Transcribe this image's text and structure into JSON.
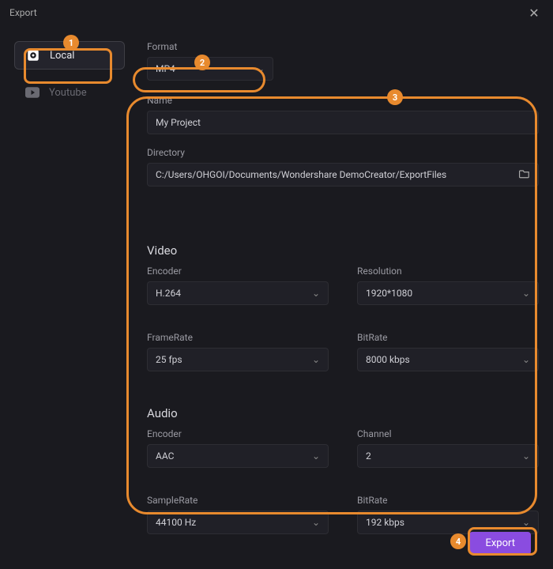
{
  "window": {
    "title": "Export"
  },
  "sidebar": {
    "local": "Local",
    "youtube": "Youtube"
  },
  "format": {
    "label": "Format",
    "value": "MP4"
  },
  "name": {
    "label": "Name",
    "value": "My Project"
  },
  "directory": {
    "label": "Directory",
    "value": "C:/Users/OHGOI/Documents/Wondershare DemoCreator/ExportFiles"
  },
  "video": {
    "title": "Video",
    "encoder": {
      "label": "Encoder",
      "value": "H.264"
    },
    "resolution": {
      "label": "Resolution",
      "value": "1920*1080"
    },
    "framerate": {
      "label": "FrameRate",
      "value": "25 fps"
    },
    "bitrate": {
      "label": "BitRate",
      "value": "8000 kbps"
    }
  },
  "audio": {
    "title": "Audio",
    "encoder": {
      "label": "Encoder",
      "value": "AAC"
    },
    "channel": {
      "label": "Channel",
      "value": "2"
    },
    "samplerate": {
      "label": "SampleRate",
      "value": "44100 Hz"
    },
    "bitrate": {
      "label": "BitRate",
      "value": "192 kbps"
    }
  },
  "footer": {
    "export": "Export"
  },
  "annotations": {
    "b1": "1",
    "b2": "2",
    "b3": "3",
    "b4": "4"
  }
}
